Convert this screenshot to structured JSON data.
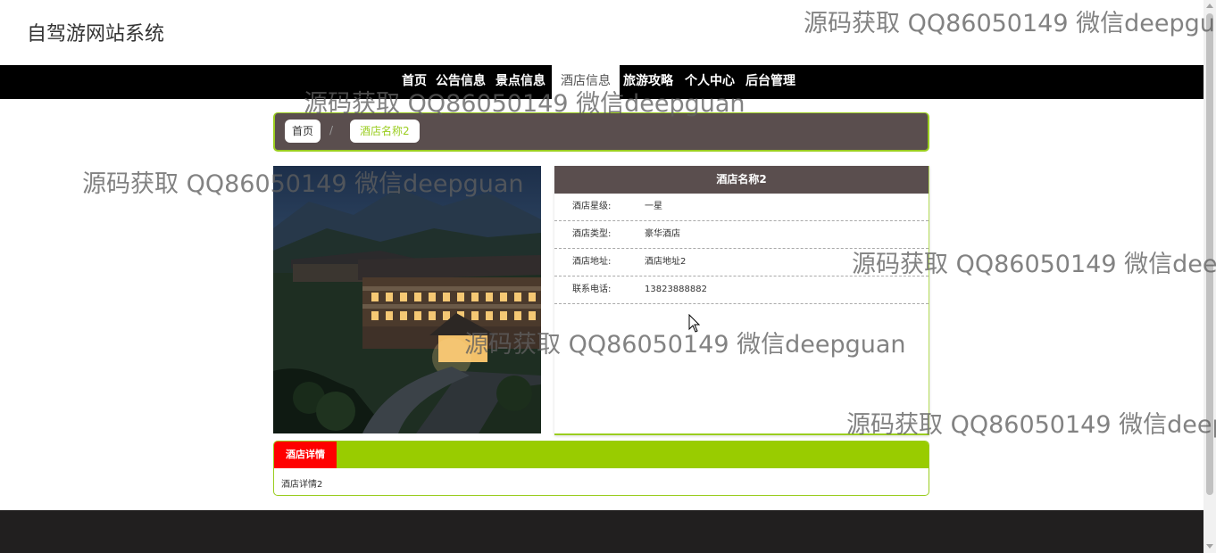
{
  "site": {
    "title": "自驾游网站系统"
  },
  "nav": {
    "items": [
      {
        "label": "首页"
      },
      {
        "label": "公告信息"
      },
      {
        "label": "景点信息"
      },
      {
        "label": "酒店信息"
      },
      {
        "label": "旅游攻略"
      },
      {
        "label": "个人中心"
      },
      {
        "label": "后台管理"
      }
    ],
    "active": "酒店信息"
  },
  "breadcrumb": {
    "home": "首页",
    "separator": "/",
    "current": "酒店名称2"
  },
  "hotel": {
    "name": "酒店名称2",
    "fields": [
      {
        "label": "酒店星级:",
        "value": "一星"
      },
      {
        "label": "酒店类型:",
        "value": "豪华酒店"
      },
      {
        "label": "酒店地址:",
        "value": "酒店地址2"
      },
      {
        "label": "联系电话:",
        "value": "13823888882"
      }
    ],
    "detail_tab": "酒店详情",
    "detail_text": "酒店详情2"
  },
  "watermark": {
    "text": "源码获取 QQ86050149 微信deepguan"
  },
  "colors": {
    "nav_bg": "#000000",
    "panel_header": "#5a4e4e",
    "accent_green": "#99cc00",
    "tab_red": "#ff0000",
    "footer_bg": "#211f1f"
  }
}
